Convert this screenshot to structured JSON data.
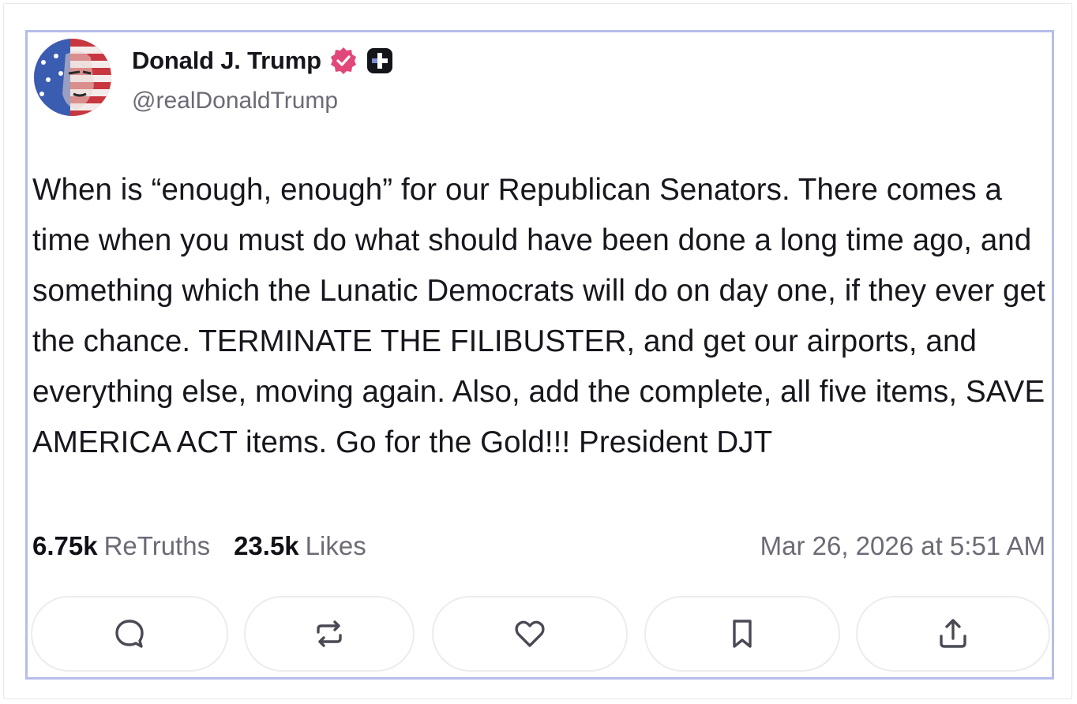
{
  "post": {
    "author": {
      "display_name": "Donald J. Trump",
      "handle": "@realDonaldTrump",
      "verified_badge_color": "#e2477a"
    },
    "body": "When is “enough, enough” for our Republican Senators. There comes a time when you must do what should have been done a long time ago, and something which the Lunatic Democrats will do on day one, if they ever get the chance. TERMINATE THE FILIBUSTER, and get our airports, and everything else, moving again. Also, add the complete, all five items, SAVE AMERICA ACT items. Go for the Gold!!! President DJT",
    "stats": {
      "retruths_count": "6.75k",
      "retruths_label": "ReTruths",
      "likes_count": "23.5k",
      "likes_label": "Likes"
    },
    "timestamp": "Mar 26, 2026 at 5:51 AM",
    "actions": [
      {
        "name": "reply",
        "icon": "comment-icon"
      },
      {
        "name": "retruth",
        "icon": "repost-icon"
      },
      {
        "name": "like",
        "icon": "heart-icon"
      },
      {
        "name": "bookmark",
        "icon": "bookmark-icon"
      },
      {
        "name": "share",
        "icon": "share-icon"
      }
    ]
  },
  "colors": {
    "post_border": "#b5bde9",
    "muted_text": "#6b6b76",
    "icon_stroke": "#4a4a55"
  }
}
